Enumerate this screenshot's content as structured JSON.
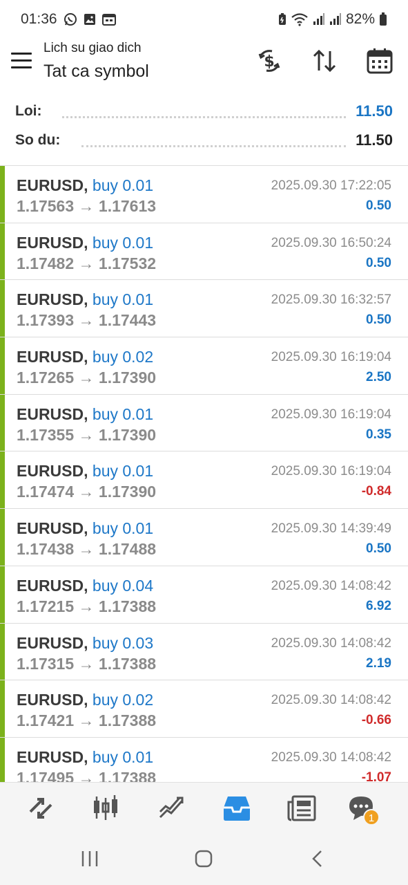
{
  "status": {
    "time": "01:36",
    "battery": "82%"
  },
  "header": {
    "subtitle": "Lich su giao dich",
    "title": "Tat ca symbol"
  },
  "summary": {
    "profit_label": "Loi:",
    "profit_value": "11.50",
    "balance_label": "So du:",
    "balance_value": "11.50"
  },
  "trades": [
    {
      "symbol": "EURUSD,",
      "side": "buy 0.01",
      "open": "1.17563",
      "close": "1.17613",
      "time": "2025.09.30 17:22:05",
      "profit": "0.50"
    },
    {
      "symbol": "EURUSD,",
      "side": "buy 0.01",
      "open": "1.17482",
      "close": "1.17532",
      "time": "2025.09.30 16:50:24",
      "profit": "0.50"
    },
    {
      "symbol": "EURUSD,",
      "side": "buy 0.01",
      "open": "1.17393",
      "close": "1.17443",
      "time": "2025.09.30 16:32:57",
      "profit": "0.50"
    },
    {
      "symbol": "EURUSD,",
      "side": "buy 0.02",
      "open": "1.17265",
      "close": "1.17390",
      "time": "2025.09.30 16:19:04",
      "profit": "2.50"
    },
    {
      "symbol": "EURUSD,",
      "side": "buy 0.01",
      "open": "1.17355",
      "close": "1.17390",
      "time": "2025.09.30 16:19:04",
      "profit": "0.35"
    },
    {
      "symbol": "EURUSD,",
      "side": "buy 0.01",
      "open": "1.17474",
      "close": "1.17390",
      "time": "2025.09.30 16:19:04",
      "profit": "-0.84"
    },
    {
      "symbol": "EURUSD,",
      "side": "buy 0.01",
      "open": "1.17438",
      "close": "1.17488",
      "time": "2025.09.30 14:39:49",
      "profit": "0.50"
    },
    {
      "symbol": "EURUSD,",
      "side": "buy 0.04",
      "open": "1.17215",
      "close": "1.17388",
      "time": "2025.09.30 14:08:42",
      "profit": "6.92"
    },
    {
      "symbol": "EURUSD,",
      "side": "buy 0.03",
      "open": "1.17315",
      "close": "1.17388",
      "time": "2025.09.30 14:08:42",
      "profit": "2.19"
    },
    {
      "symbol": "EURUSD,",
      "side": "buy 0.02",
      "open": "1.17421",
      "close": "1.17388",
      "time": "2025.09.30 14:08:42",
      "profit": "-0.66"
    },
    {
      "symbol": "EURUSD,",
      "side": "buy 0.01",
      "open": "1.17495",
      "close": "1.17388",
      "time": "2025.09.30 14:08:42",
      "profit": "-1.07"
    }
  ],
  "bottom_nav": {
    "chat_badge": "1"
  },
  "colors": {
    "accent": "#1e78c8",
    "buy_bar": "#7cb21c",
    "loss": "#d02b2b",
    "badge": "#f0a020"
  }
}
